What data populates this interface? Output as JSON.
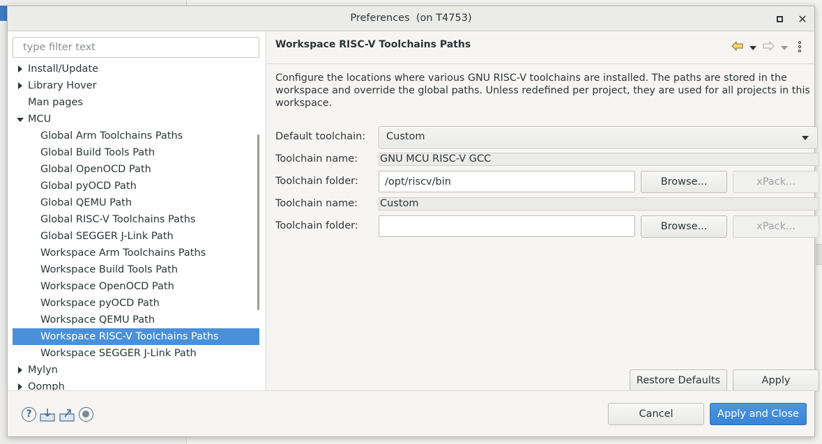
{
  "window": {
    "title": "Preferences  (on T4753)"
  },
  "filter": {
    "placeholder": "type filter text",
    "value": ""
  },
  "tree": {
    "items": [
      {
        "label": "Install/Update",
        "level": 0,
        "expander": "collapsed"
      },
      {
        "label": "Library Hover",
        "level": 0,
        "expander": "collapsed"
      },
      {
        "label": "Man pages",
        "level": 0,
        "expander": "none"
      },
      {
        "label": "MCU",
        "level": 0,
        "expander": "expanded"
      },
      {
        "label": "Global Arm Toolchains Paths",
        "level": 1,
        "expander": "none"
      },
      {
        "label": "Global Build Tools Path",
        "level": 1,
        "expander": "none"
      },
      {
        "label": "Global OpenOCD Path",
        "level": 1,
        "expander": "none"
      },
      {
        "label": "Global pyOCD Path",
        "level": 1,
        "expander": "none"
      },
      {
        "label": "Global QEMU Path",
        "level": 1,
        "expander": "none"
      },
      {
        "label": "Global RISC-V Toolchains Paths",
        "level": 1,
        "expander": "none"
      },
      {
        "label": "Global SEGGER J-Link Path",
        "level": 1,
        "expander": "none"
      },
      {
        "label": "Workspace Arm Toolchains Paths",
        "level": 1,
        "expander": "none"
      },
      {
        "label": "Workspace Build Tools Path",
        "level": 1,
        "expander": "none"
      },
      {
        "label": "Workspace OpenOCD Path",
        "level": 1,
        "expander": "none"
      },
      {
        "label": "Workspace pyOCD Path",
        "level": 1,
        "expander": "none"
      },
      {
        "label": "Workspace QEMU Path",
        "level": 1,
        "expander": "none"
      },
      {
        "label": "Workspace RISC-V Toolchains Paths",
        "level": 1,
        "expander": "none",
        "selected": true
      },
      {
        "label": "Workspace SEGGER J-Link Path",
        "level": 1,
        "expander": "none"
      },
      {
        "label": "Mylyn",
        "level": 0,
        "expander": "collapsed"
      },
      {
        "label": "Oomph",
        "level": 0,
        "expander": "collapsed"
      }
    ]
  },
  "page": {
    "title": "Workspace RISC-V Toolchains Paths",
    "description": "Configure the locations where various GNU RISC-V toolchains are installed. The paths are stored in the workspace and override the global paths. Unless redefined per project, they are used for all projects in this workspace.",
    "default_toolchain_label": "Default toolchain:",
    "default_toolchain_value": "Custom",
    "toolchains": [
      {
        "name_label": "Toolchain name:",
        "name_value": "GNU MCU RISC-V GCC",
        "folder_label": "Toolchain folder:",
        "folder_value": "/opt/riscv/bin",
        "browse_label": "Browse...",
        "xpack_label": "xPack..."
      },
      {
        "name_label": "Toolchain name:",
        "name_value": "Custom",
        "folder_label": "Toolchain folder:",
        "folder_value": "",
        "browse_label": "Browse...",
        "xpack_label": "xPack..."
      }
    ],
    "restore_defaults_label": "Restore Defaults",
    "apply_label": "Apply"
  },
  "footer": {
    "cancel_label": "Cancel",
    "apply_close_label": "Apply and Close"
  },
  "colors": {
    "selection": "#4a90d9",
    "primary_button": "#3a84d4"
  }
}
